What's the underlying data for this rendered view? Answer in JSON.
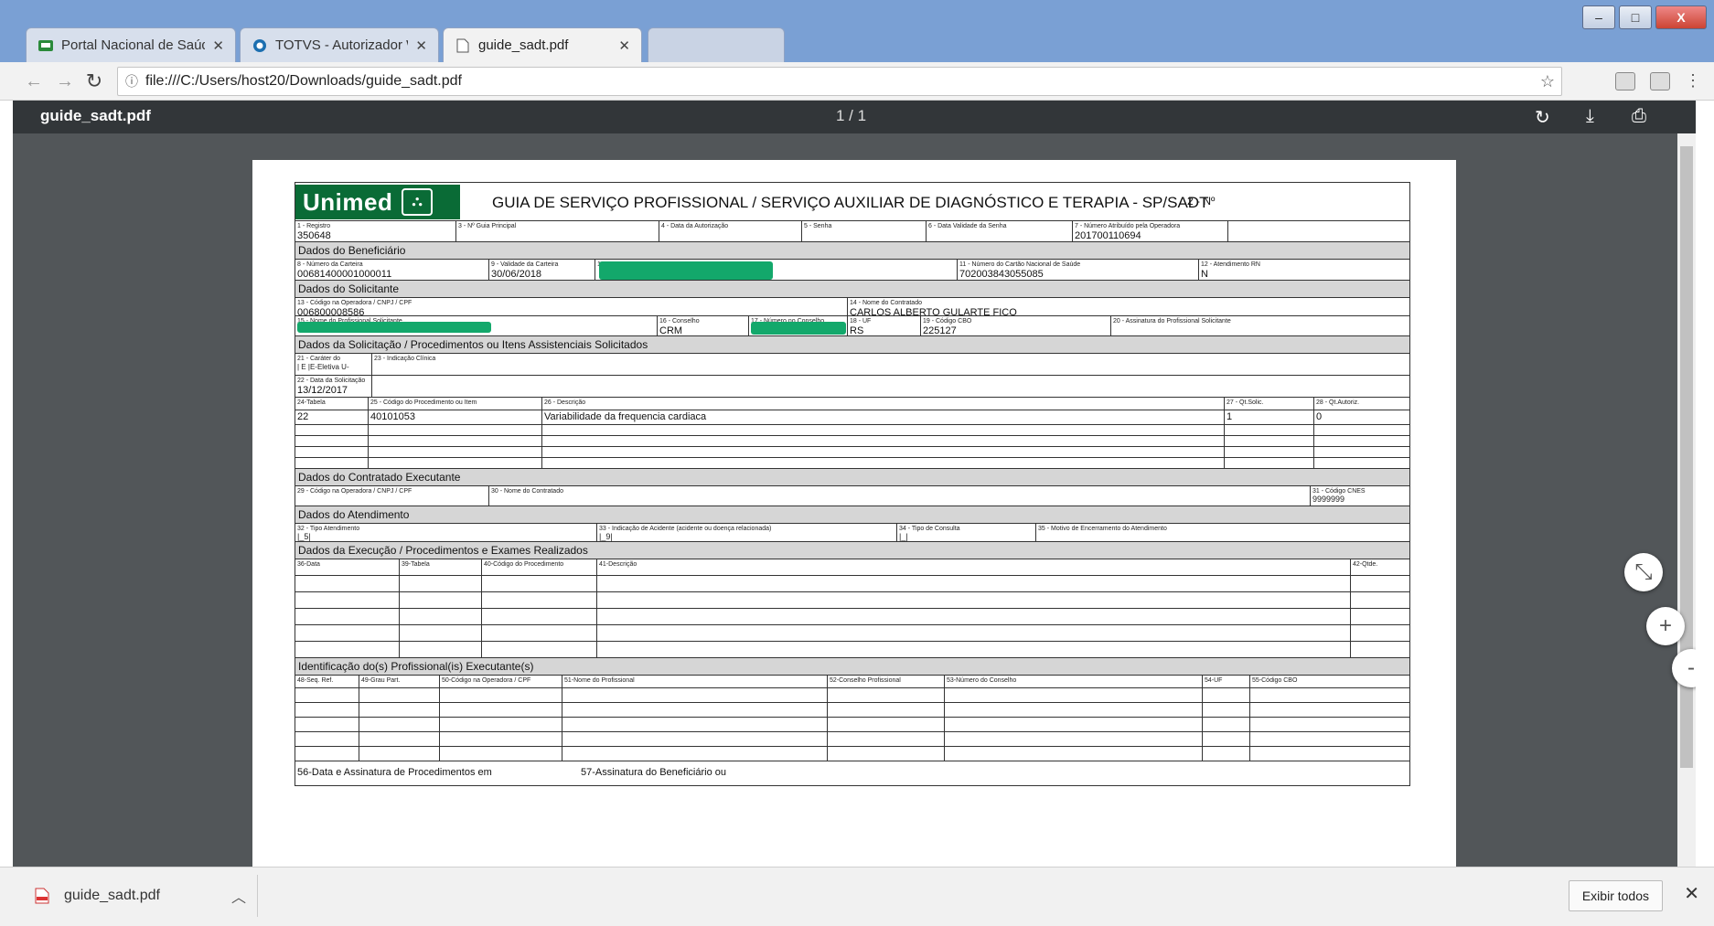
{
  "browser": {
    "tabs": [
      {
        "label": "Portal Nacional de Saúde",
        "icon": "portal-icon"
      },
      {
        "label": "TOTVS - Autorizador WE",
        "icon": "totvs-icon"
      },
      {
        "label": "guide_sadt.pdf",
        "icon": "document-icon"
      }
    ],
    "url": "file:///C:/Users/host20/Downloads/guide_sadt.pdf",
    "window_controls": {
      "minimize": "–",
      "maximize": "□",
      "close": "X"
    }
  },
  "pdf_viewer": {
    "title": "guide_sadt.pdf",
    "page_indicator": "1 / 1"
  },
  "form": {
    "logo_text": "Unimed",
    "title": "GUIA DE SERVIÇO PROFISSIONAL / SERVIÇO AUXILIAR DE DIAGNÓSTICO E TERAPIA - SP/SADT",
    "number_label": "2 - Nº",
    "registro_label": "1 - Registro",
    "registro": "350648",
    "guia_principal_label": "3 - Nº Guia Principal",
    "data_autorizacao_label": "4 - Data da Autorização",
    "senha_label": "5 - Senha",
    "validade_senha_label": "6 - Data Validade da Senha",
    "numero_operadora_label": "7 - Número Atribuído pela Operadora",
    "numero_operadora": "201700110694",
    "sec_beneficiario": "Dados do Beneficiário",
    "carteira_label": "8 - Número da Carteira",
    "carteira": "00681400001000011",
    "validade_carteira_label": "9 - Validade da Carteira",
    "validade_carteira": "30/06/2018",
    "nome_label": "10 - Nome",
    "cns_label": "11 - Número do Cartão Nacional de Saúde",
    "cns": "702003843055085",
    "rn_label": "12 - Atendimento RN",
    "rn": "N",
    "sec_solicitante": "Dados do Solicitante",
    "cod_operadora_label": "13 - Código na Operadora / CNPJ / CPF",
    "cod_operadora": "006800008586",
    "nome_contratado_label": "14 - Nome do Contratado",
    "nome_contratado": "CARLOS ALBERTO GULARTE FICO",
    "nome_prof_label": "15 - Nome do Profissional Solicitante",
    "conselho_label": "16 - Conselho",
    "conselho": "CRM",
    "num_conselho_label": "17 - Número no Conselho",
    "uf_label": "18 - UF",
    "uf": "RS",
    "cbo_label": "19 - Código CBO",
    "cbo": "225127",
    "assinatura_label": "20 - Assinatura do Profissional Solicitante",
    "sec_solicitacao": "Dados da Solicitação / Procedimentos ou Itens Assistenciais Solicitados",
    "carater_label": "21 - Caráter do",
    "carater": "| E |E-Eletiva  U-",
    "indicacao_label": "23 - Indicação Clínica",
    "data_solic_label": "22 - Data da Solicitação",
    "data_solic": "13/12/2017",
    "col_tabela": "24-Tabela",
    "col_codigo": "25 - Código do Procedimento ou Item",
    "col_descricao": "26 - Descrição",
    "col_qt_solic": "27 - Qt.Solic.",
    "col_qt_autoriz": "28 - Qt.Autoriz.",
    "proc_tabela": "22",
    "proc_codigo": "40101053",
    "proc_descricao": "Variabilidade da frequencia cardiaca",
    "proc_qt_solic": "1",
    "proc_qt_autoriz": "0",
    "sec_executante": "Dados do Contratado Executante",
    "exec_cod_label": "29 - Código na Operadora / CNPJ / CPF",
    "exec_nome_label": "30 - Nome do Contratado",
    "cnes_label": "31 - Código CNES",
    "cnes": "9999999",
    "sec_atendimento": "Dados do Atendimento",
    "tipo_atend_label": "32 - Tipo Atendimento",
    "tipo_atend": "|_5|",
    "acidente_label": "33 - Indicação de Acidente (acidente ou doença relacionada)",
    "acidente": "|_9|",
    "tipo_consulta_label": "34 - Tipo de Consulta",
    "tipo_consulta": "|_|",
    "motivo_label": "35 - Motivo de Encerramento do Atendimento",
    "sec_execucao": "Dados da Execução / Procedimentos e Exames Realizados",
    "exec_data": "36-Data",
    "exec_tabela": "39-Tabela",
    "exec_codigo": "40-Código do Procedimento",
    "exec_descricao": "41-Descrição",
    "exec_qtde": "42-Qtde.",
    "sec_profissionais": "Identificação do(s) Profissional(is) Executante(s)",
    "prof_seq": "48-Seq. Ref.",
    "prof_grau": "49-Grau Part.",
    "prof_cod": "50-Código na Operadora / CPF",
    "prof_nome": "51-Nome do Profissional",
    "prof_conselho": "52-Conselho Profissional",
    "prof_num_conselho": "53-Número do Conselho",
    "prof_uf": "54-UF",
    "prof_cbo": "55-Código CBO",
    "foot_56": "56-Data e Assinatura de Procedimentos em",
    "foot_57": "57-Assinatura do Beneficiário ou"
  },
  "downloads": {
    "file": "guide_sadt.pdf",
    "show_all": "Exibir todos"
  }
}
